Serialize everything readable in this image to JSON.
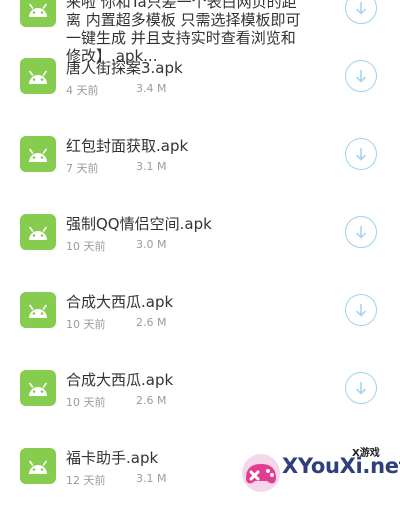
{
  "files": [
    {
      "name": "唐人街探案3.apk",
      "age": "4 天前",
      "size": "3.4 M"
    },
    {
      "name": "红包封面获取.apk",
      "age": "7 天前",
      "size": "3.1 M"
    },
    {
      "name": "强制QQ情侣空间.apk",
      "age": "10 天前",
      "size": "3.0 M"
    },
    {
      "name": "合成大西瓜.apk",
      "age": "10 天前",
      "size": "2.6 M"
    },
    {
      "name": "合成大西瓜.apk",
      "age": "10 天前",
      "size": "2.6 M"
    },
    {
      "name": "福卡助手.apk",
      "age": "12 天前",
      "size": "3.1 M"
    }
  ],
  "overflow_desc": {
    "line1": "来啦 你和Ta只差一个表白网页的距",
    "line2": "离 内置超多模板 只需选择模板即可",
    "line3": "一键生成 并且支持实时查看浏览和",
    "line4": "修改】.apk..."
  },
  "watermark": {
    "text": "XYouXi.net",
    "label": "X游戏"
  },
  "colors": {
    "icon_bg": "#86cc4f",
    "download_ring": "#9fd2ef",
    "text": "#333333",
    "meta": "#9c9c9c",
    "watermark": "#2e3f7c"
  },
  "icons": {
    "app": "android-icon",
    "download": "download-arrow-icon"
  }
}
